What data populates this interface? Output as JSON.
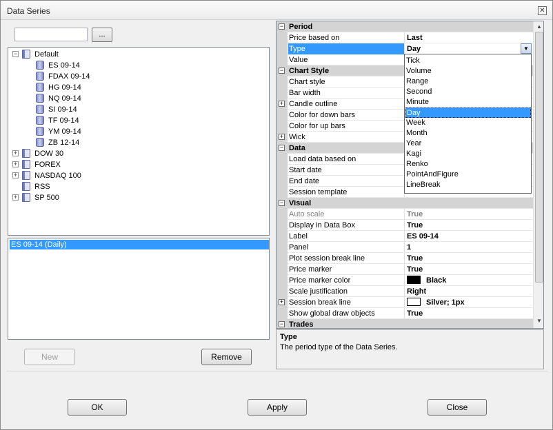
{
  "window": {
    "title": "Data Series"
  },
  "search": {
    "value": "",
    "browse_label": "..."
  },
  "tree": {
    "root": "Default",
    "children": [
      "ES 09-14",
      "FDAX 09-14",
      "HG 09-14",
      "NQ 09-14",
      "SI 09-14",
      "TF 09-14",
      "YM 09-14",
      "ZB 12-14"
    ],
    "groups": [
      "DOW 30",
      "FOREX",
      "NASDAQ 100",
      "RSS",
      "SP 500"
    ]
  },
  "selected_series": [
    "ES 09-14 (Daily)"
  ],
  "left_buttons": {
    "new": "New",
    "remove": "Remove"
  },
  "properties": [
    {
      "type": "cat",
      "name": "Period"
    },
    {
      "name": "Price based on",
      "value": "Last"
    },
    {
      "name": "Type",
      "value": "Day",
      "selected": true
    },
    {
      "name": "Value",
      "value": ""
    },
    {
      "type": "cat",
      "name": "Chart Style"
    },
    {
      "name": "Chart style",
      "value": ""
    },
    {
      "name": "Bar width",
      "value": ""
    },
    {
      "name": "Candle outline",
      "value": "",
      "expand": true
    },
    {
      "name": "Color for down bars",
      "value": ""
    },
    {
      "name": "Color for up bars",
      "value": ""
    },
    {
      "name": "Wick",
      "value": "",
      "expand": true
    },
    {
      "type": "cat",
      "name": "Data"
    },
    {
      "name": "Load data based on",
      "value": ""
    },
    {
      "name": "Start date",
      "value": ""
    },
    {
      "name": "End date",
      "value": ""
    },
    {
      "name": "Session template",
      "value": ""
    },
    {
      "type": "cat",
      "name": "Visual"
    },
    {
      "name": "Auto scale",
      "value": "True",
      "disabled": true
    },
    {
      "name": "Display in Data Box",
      "value": "True"
    },
    {
      "name": "Label",
      "value": "ES 09-14"
    },
    {
      "name": "Panel",
      "value": "1"
    },
    {
      "name": "Plot session break line",
      "value": "True"
    },
    {
      "name": "Price marker",
      "value": "True"
    },
    {
      "name": "Price marker color",
      "value": "Black",
      "swatch": "#000000"
    },
    {
      "name": "Scale justification",
      "value": "Right"
    },
    {
      "name": "Session break line",
      "value": "Silver;  1px",
      "swatch": "#ffffff",
      "expand": true
    },
    {
      "name": "Show global draw objects",
      "value": "True"
    },
    {
      "type": "cat",
      "name": "Trades"
    }
  ],
  "dropdown": {
    "options": [
      "Tick",
      "Volume",
      "Range",
      "Second",
      "Minute",
      "Day",
      "Week",
      "Month",
      "Year",
      "Kagi",
      "Renko",
      "PointAndFigure",
      "LineBreak"
    ],
    "selected": "Day"
  },
  "description": {
    "title": "Type",
    "text": "The period type of the Data Series."
  },
  "footer_buttons": {
    "ok": "OK",
    "apply": "Apply",
    "close": "Close"
  },
  "colors": {
    "selection": "#3399ff",
    "category_bg": "#d4d4d4"
  }
}
